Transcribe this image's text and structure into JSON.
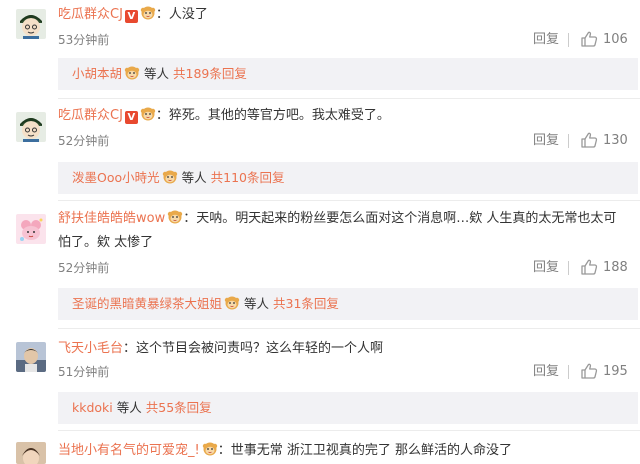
{
  "comments": [
    {
      "name": "吃瓜群众CJ",
      "badge": "V",
      "text": "：人没了",
      "time": "53分钟前",
      "reply_label": "回复",
      "likes": "106",
      "replies": {
        "name": "小胡本胡",
        "etc": "等人",
        "count": "共189条回复"
      }
    },
    {
      "name": "吃瓜群众CJ",
      "badge": "V",
      "text": "：猝死。其他的等官方吧。我太难受了。",
      "time": "52分钟前",
      "reply_label": "回复",
      "likes": "130",
      "replies": {
        "name": "泼墨Ooo小時光",
        "etc": "等人",
        "count": "共110条回复"
      }
    },
    {
      "name": "舒扶佳皓皓皓wow",
      "text": "：天呐。明天起来的粉丝要怎么面对这个消息啊…欸 人生真的太无常也太可",
      "text2": "怕了。欸 太惨了",
      "time": "52分钟前",
      "reply_label": "回复",
      "likes": "188",
      "replies": {
        "name": "圣诞的黑暗黄暴绿茶大姐姐",
        "etc": "等人",
        "count": "共31条回复"
      }
    },
    {
      "name": "飞天小毛台",
      "text": "：这个节目会被问责吗？这么年轻的一个人啊",
      "time": "51分钟前",
      "reply_label": "回复",
      "likes": "195",
      "replies": {
        "name": "kkdoki",
        "etc": "等人",
        "count": "共55条回复"
      }
    },
    {
      "name": "当地小有名气的可爱宠_!",
      "text": "：世事无常 浙江卫视真的完了 那么鲜活的人命没了"
    }
  ],
  "icons": {
    "like": "thumbs-up-icon",
    "emoji": "monkey-emoji-icon"
  },
  "colors": {
    "name": "#eb7350",
    "meta": "#808080",
    "reply_bg": "#f2f2f5",
    "badge": "#e8492f"
  }
}
